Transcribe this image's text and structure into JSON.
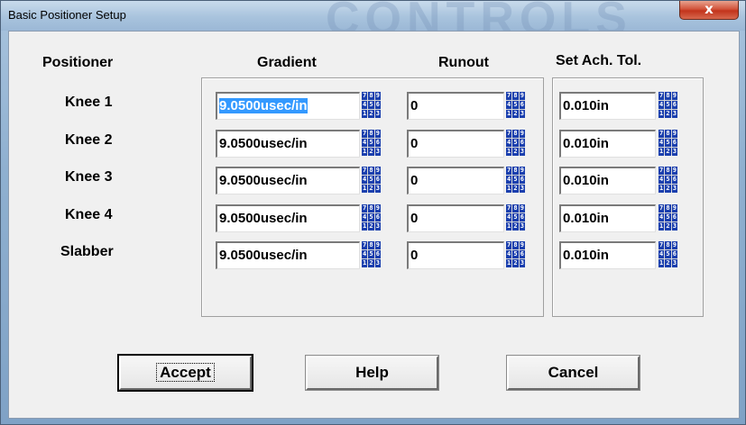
{
  "window": {
    "title": "Basic Positioner Setup",
    "close_glyph": "x",
    "watermark": "CONTROLS"
  },
  "headers": {
    "positioner": "Positioner",
    "gradient": "Gradient",
    "runout": "Runout",
    "set_ach_tol": "Set Ach. Tol."
  },
  "rows": [
    {
      "name": "Knee 1",
      "gradient": "9.0500usec/in",
      "runout": "0",
      "tol": "0.010in"
    },
    {
      "name": "Knee 2",
      "gradient": "9.0500usec/in",
      "runout": "0",
      "tol": "0.010in"
    },
    {
      "name": "Knee 3",
      "gradient": "9.0500usec/in",
      "runout": "0",
      "tol": "0.010in"
    },
    {
      "name": "Knee 4",
      "gradient": "9.0500usec/in",
      "runout": "0",
      "tol": "0.010in"
    },
    {
      "name": "Slabber",
      "gradient": "9.0500usec/in",
      "runout": "0",
      "tol": "0.010in"
    }
  ],
  "keypad": {
    "icon": "numeric-keypad-icon",
    "keys": [
      "7",
      "8",
      "9",
      "4",
      "5",
      "6",
      "1",
      "2",
      "3"
    ]
  },
  "buttons": {
    "accept": "Accept",
    "help": "Help",
    "cancel": "Cancel"
  },
  "colors": {
    "selection": "#3399ff",
    "keypad_bg": "#1a3fae",
    "close_button": "#c2341c"
  }
}
